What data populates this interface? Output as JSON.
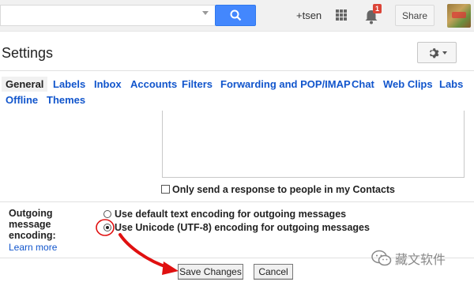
{
  "topbar": {
    "search_value": "",
    "user": "+tsen",
    "notification_count": "1",
    "share_label": "Share",
    "icons": [
      "search-icon",
      "apps-grid-icon",
      "bell-icon",
      "avatar"
    ]
  },
  "header": {
    "title": "Settings",
    "gear_icon": "gear-icon"
  },
  "tabs": [
    {
      "label": "General",
      "active": true
    },
    {
      "label": "Labels"
    },
    {
      "label": "Inbox"
    },
    {
      "label": "Accounts"
    },
    {
      "label": "Filters"
    },
    {
      "label": "Forwarding and POP/IMAP"
    },
    {
      "label": "Chat"
    },
    {
      "label": "Web Clips"
    },
    {
      "label": "Labs"
    },
    {
      "label": "Offline"
    },
    {
      "label": "Themes"
    }
  ],
  "vacation": {
    "contacts_only_label": "Only send a response to people in my Contacts",
    "contacts_only_checked": false
  },
  "encoding": {
    "label": "Outgoing message encoding:",
    "learn_more": "Learn more",
    "options": [
      {
        "label": "Use default text encoding for outgoing messages",
        "checked": false
      },
      {
        "label": "Use Unicode (UTF-8) encoding for outgoing messages",
        "checked": true
      }
    ]
  },
  "actions": {
    "save_label": "Save Changes",
    "cancel_label": "Cancel"
  },
  "watermark": {
    "text": "藏文软件",
    "icon": "wechat-icon"
  },
  "colors": {
    "link": "#1155cc",
    "search_button": "#4387fd",
    "badge": "#db4437",
    "annotation": "#e01010"
  }
}
